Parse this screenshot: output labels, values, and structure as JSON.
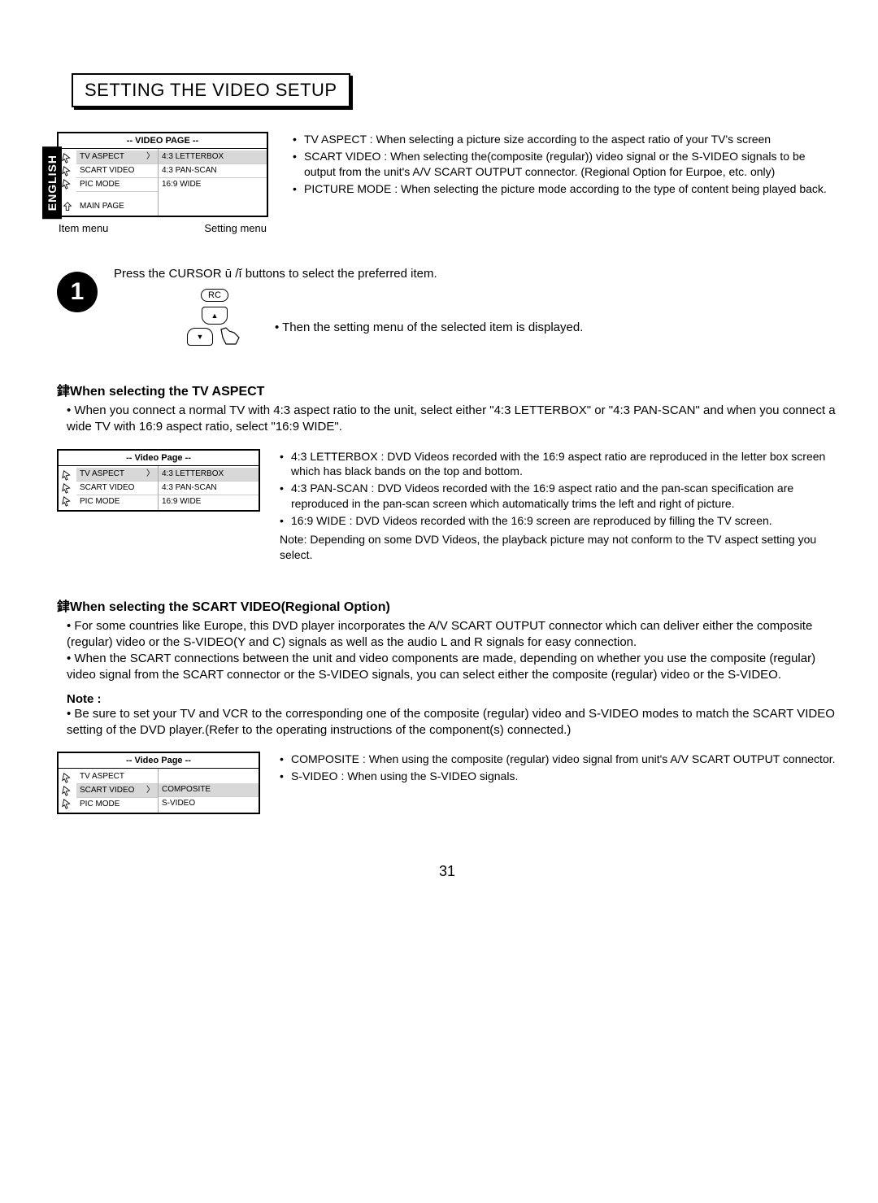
{
  "language_tab": "ENGLISH",
  "section_title": "SETTING THE VIDEO SETUP",
  "menu1": {
    "header": "-- VIDEO PAGE --",
    "left": [
      "TV ASPECT",
      "SCART VIDEO",
      "PIC MODE",
      "",
      "MAIN PAGE"
    ],
    "right": [
      "4:3  LETTERBOX",
      "4:3 PAN-SCAN",
      "16:9 WIDE"
    ],
    "selected_left": 0,
    "selected_right": 0,
    "caption_left": "Item menu",
    "caption_right": "Setting menu"
  },
  "top_bullets": [
    {
      "lead": "TV ASPECT : ",
      "text": "When selecting a picture size according to the aspect ratio of your TV's screen"
    },
    {
      "lead": "SCART VIDEO : ",
      "text": "When selecting the(composite (regular)) video signal or the S-VIDEO signals to be output from the unit's A/V SCART OUTPUT connector. (Regional Option for Eurpoe, etc. only)"
    },
    {
      "lead": "PICTURE MODE : ",
      "text": "When selecting the picture mode according to the type of content being played back."
    }
  ],
  "step1": {
    "number": "1",
    "instruction": "Press the CURSOR ū /ĭ    buttons to select the preferred item.",
    "rc_label": "RC",
    "result": "• Then the setting menu of the selected item is displayed."
  },
  "tv_aspect": {
    "heading": "銉When selecting the TV ASPECT",
    "para": "• When you connect a normal TV with 4:3 aspect ratio to the unit, select either \"4:3 LETTERBOX\" or \"4:3 PAN-SCAN\" and when you connect a wide TV with 16:9 aspect ratio, select \"16:9 WIDE\".",
    "menu": {
      "header": "-- Video Page --",
      "left": [
        "TV ASPECT",
        "SCART VIDEO",
        "PIC MODE"
      ],
      "right": [
        "4:3  LETTERBOX",
        "4:3 PAN-SCAN",
        "16:9 WIDE"
      ],
      "selected_left": 0,
      "selected_right": 0
    },
    "bullets": [
      {
        "lead": "4:3 LETTERBOX : ",
        "text": "DVD Videos recorded with the 16:9 aspect ratio are reproduced in the letter box screen which has black bands on the top and bottom."
      },
      {
        "lead": "4:3 PAN-SCAN : ",
        "text": "DVD Videos recorded with the 16:9 aspect ratio and the pan-scan specification are reproduced in the pan-scan screen which automatically trims the left and right of picture."
      },
      {
        "lead": "16:9 WIDE : ",
        "text": "DVD Videos recorded with the 16:9 screen are reproduced by filling the TV screen."
      }
    ],
    "note": "Note: Depending on some DVD Videos, the playback picture may not conform to the TV aspect setting you select."
  },
  "scart": {
    "heading": "銉When selecting the SCART VIDEO(Regional Option)",
    "paras": [
      "• For some countries like Europe, this DVD player incorporates the A/V SCART OUTPUT connector which can deliver either the composite (regular) video or the S-VIDEO(Y and C) signals as well as the audio L and R signals for easy connection.",
      "• When the SCART connections between the unit and video components are made, depending on whether you use the composite (regular) video signal from the SCART connector or the S-VIDEO signals, you can select either the composite (regular) video or the S-VIDEO."
    ],
    "note_label": "Note :",
    "note": "• Be sure to set your TV and VCR to the corresponding one of the composite (regular) video and S-VIDEO modes to match the SCART VIDEO setting of the DVD player.(Refer to the operating instructions of the component(s) connected.)",
    "menu": {
      "header": "-- Video Page --",
      "left": [
        "TV ASPECT",
        "SCART VIDEO",
        "PIC MODE"
      ],
      "right": [
        "",
        "COMPOSITE",
        "S-VIDEO"
      ],
      "selected_left": 1,
      "selected_right": 1
    },
    "bullets": [
      {
        "lead": "COMPOSITE : ",
        "text": "When using the composite (regular) video signal from unit's A/V SCART OUTPUT connector."
      },
      {
        "lead": "S-VIDEO : ",
        "text": "When using the S-VIDEO signals."
      }
    ]
  },
  "page_number": "31"
}
